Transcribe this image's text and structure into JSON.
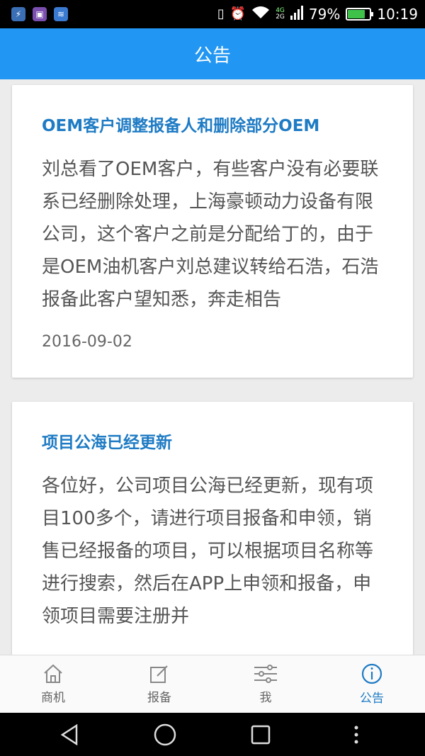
{
  "status_bar": {
    "battery_percent_label": "79%",
    "battery_level": 0.79,
    "time": "10:19",
    "network_top": "4G",
    "network_bottom": "2G",
    "app_icon_colors": [
      "#3b6fb5",
      "#7b4fb0",
      "#3a7ad0"
    ]
  },
  "header": {
    "title": "公告"
  },
  "announcements": [
    {
      "title": "OEM客户调整报备人和删除部分OEM",
      "body": "刘总看了OEM客户，有些客户没有必要联系已经删除处理，上海豪顿动力设备有限公司，这个客户之前是分配给丁的，由于是OEM油机客户刘总建议转给石浩，石浩报备此客户望知悉，奔走相告",
      "date": "2016-09-02"
    },
    {
      "title": "项目公海已经更新",
      "body": "各位好，公司项目公海已经更新，现有项目100多个，请进行项目报备和申领，销售已经报备的项目，可以根据项目名称等进行搜索，然后在APP上申领和报备，申领项目需要注册并",
      "date": ""
    }
  ],
  "bottom_nav": {
    "items": [
      {
        "label": "商机",
        "icon": "home-icon"
      },
      {
        "label": "报备",
        "icon": "edit-icon"
      },
      {
        "label": "我",
        "icon": "sliders-icon"
      },
      {
        "label": "公告",
        "icon": "info-icon"
      }
    ],
    "active_index": 3
  },
  "colors": {
    "primary": "#2196f3",
    "title_blue": "#1e7bc4",
    "background": "#ececec"
  }
}
